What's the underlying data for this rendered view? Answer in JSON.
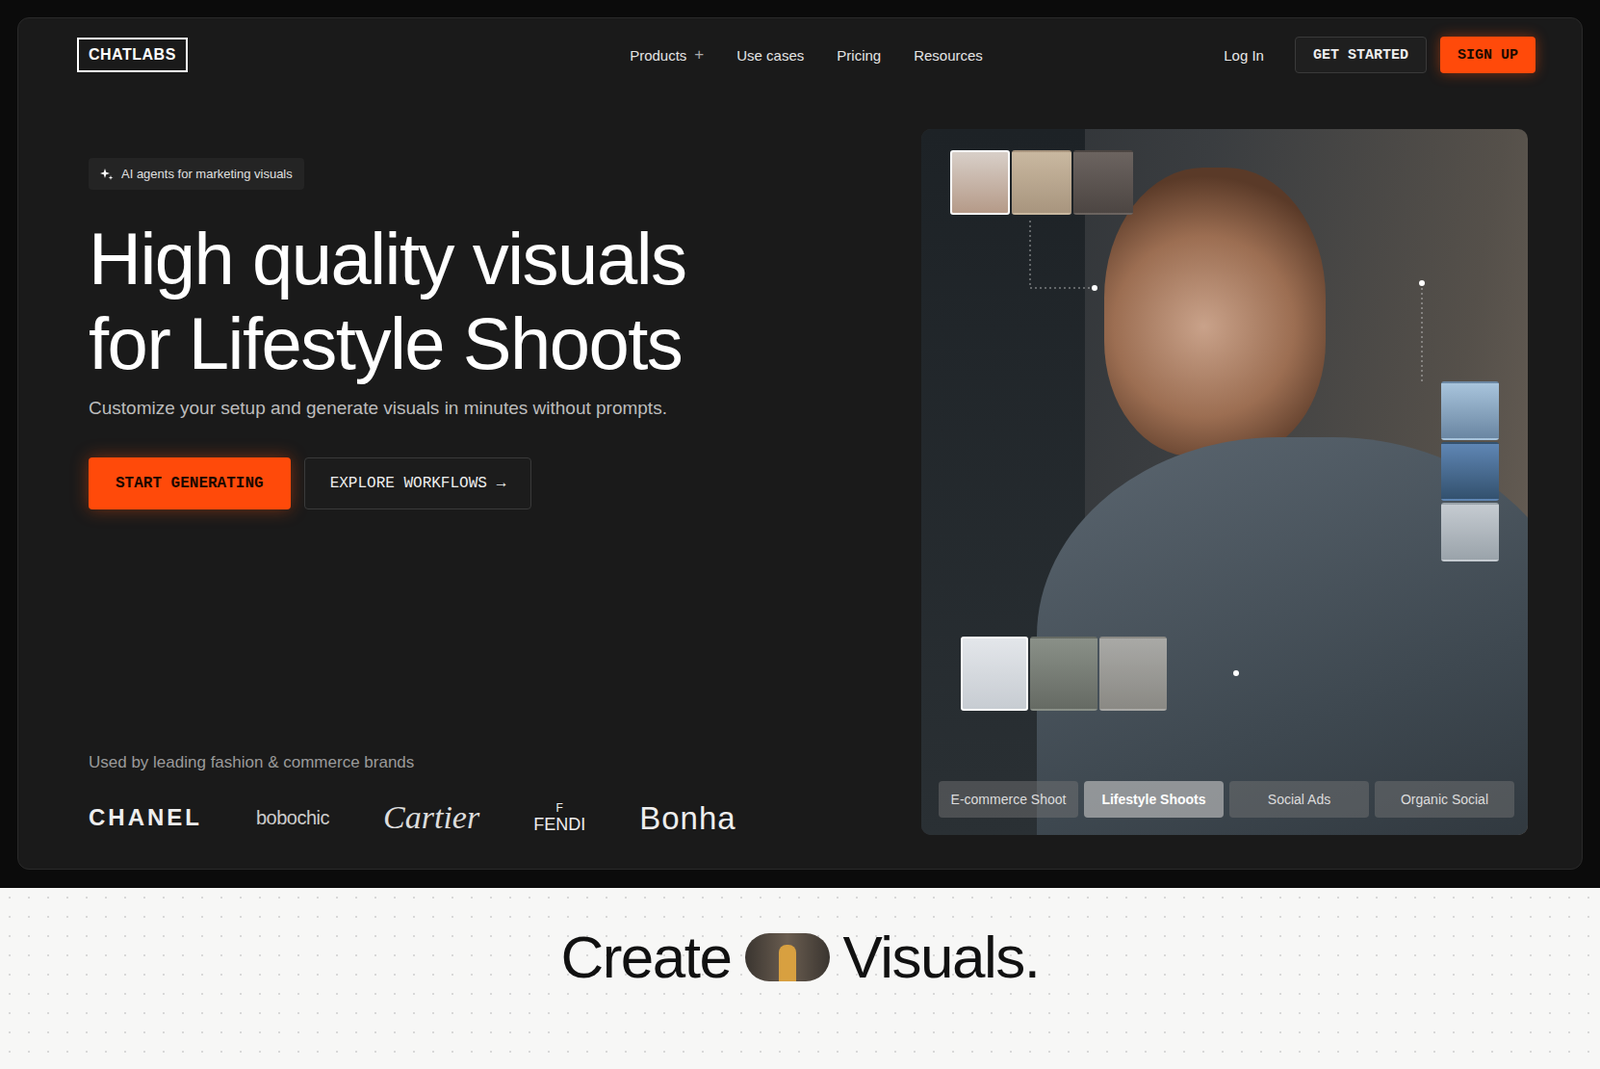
{
  "brand": "CHATLABS",
  "nav": [
    {
      "label": "Products",
      "icon": "+"
    },
    {
      "label": "Use cases",
      "icon": ""
    },
    {
      "label": "Pricing",
      "icon": ""
    },
    {
      "label": "Resources",
      "icon": ""
    }
  ],
  "nav_actions": {
    "login": "Log In",
    "get_started": "GET STARTED",
    "sign_up": "SIGN UP"
  },
  "hero": {
    "badge": "AI agents for marketing visuals",
    "title_lines": [
      "High quality visuals",
      "for Lifestyle Shoots"
    ],
    "subtitle": "Customize your setup and generate visuals in minutes without prompts.",
    "primary_button": "START GENERATING",
    "secondary_button": "EXPLORE WORKFLOWS",
    "secondary_arrow": "→"
  },
  "brands": {
    "caption": "Used by leading fashion & commerce brands",
    "logos": [
      {
        "name": "CHANEL",
        "kind": "wide",
        "mark": ""
      },
      {
        "name": "bobochic",
        "kind": "thin",
        "mark": ""
      },
      {
        "name": "Cartier",
        "kind": "script",
        "mark": ""
      },
      {
        "name": "FENDI",
        "kind": "stacked",
        "mark": "F"
      },
      {
        "name": "Bonha",
        "kind": "cut",
        "mark": ""
      }
    ]
  },
  "preview": {
    "models": [
      {
        "selected": true
      },
      {
        "selected": false
      },
      {
        "selected": false
      }
    ],
    "locations": [
      {
        "selected": false
      },
      {
        "selected": false
      },
      {
        "selected": false
      }
    ],
    "garments": [
      {
        "selected": true
      },
      {
        "selected": false
      },
      {
        "selected": false
      }
    ],
    "tabs": [
      {
        "label": "E-commerce Shoot",
        "selected": false
      },
      {
        "label": "Lifestyle Shoots",
        "selected": true
      },
      {
        "label": "Social Ads",
        "selected": false
      },
      {
        "label": "Organic Social",
        "selected": false
      }
    ]
  },
  "section": {
    "title_before": "Create",
    "title_after": "Visuals."
  }
}
